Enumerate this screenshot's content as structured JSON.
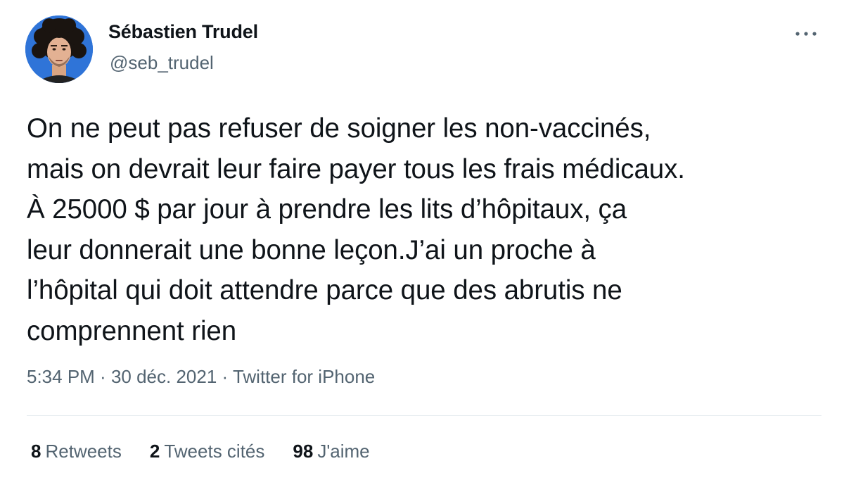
{
  "author": {
    "name": "Sébastien Trudel",
    "handle": "@seb_trudel"
  },
  "more_icon": "more-horizontal-icon",
  "tweet": {
    "text": "On ne peut pas refuser de soigner les non-vaccinés,\nmais on devrait leur faire payer tous les frais médicaux.\nÀ 25000 $ par jour à prendre les lits d’hôpitaux, ça\nleur donnerait une bonne leçon.J’ai un proche à\nl’hôpital qui doit attendre parce que des abrutis ne\ncomprennent rien"
  },
  "meta": {
    "time": "5:34 PM",
    "separator": " · ",
    "date": "30 déc. 2021",
    "source": "Twitter for iPhone"
  },
  "stats": {
    "retweets": {
      "count": "8",
      "label": "Retweets"
    },
    "quotes": {
      "count": "2",
      "label": "Tweets cités"
    },
    "likes": {
      "count": "98",
      "label": "J'aime"
    }
  },
  "colors": {
    "text": "#0f1419",
    "secondary": "#536471",
    "divider": "#e6ecf0",
    "avatar_bg": "#2a6fd6"
  }
}
